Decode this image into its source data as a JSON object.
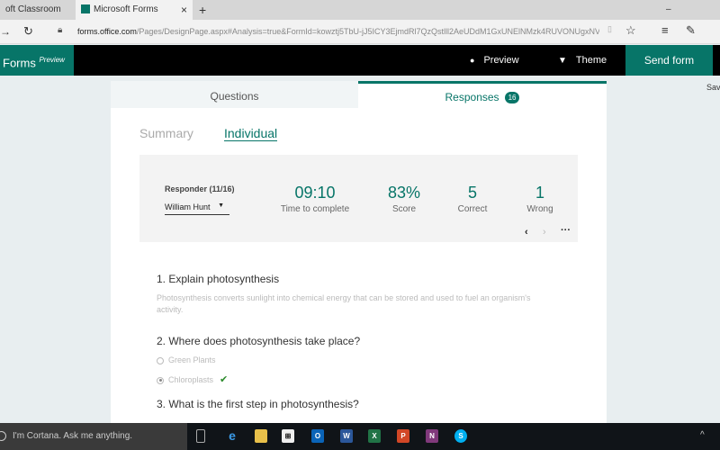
{
  "browser": {
    "tabs": [
      {
        "label": "oft Classroom"
      },
      {
        "label": "Microsoft Forms"
      }
    ],
    "new_tab": "+",
    "close": "×",
    "minimize": "–",
    "url_domain": "forms.office.com",
    "url_path": "/Pages/DesignPage.aspx#Analysis=true&FormId=kowztj5TbU-jJ5ICY3EjmdRl7QzQstlll2AeUDdM1GxUNElNMzk4RUVONUgxNVMyRVcwUlh"
  },
  "app": {
    "brand": "Forms",
    "brand_tag": "Preview",
    "preview": "Preview",
    "theme": "Theme",
    "send": "Send form",
    "saved": "Sav"
  },
  "tabs": {
    "questions": "Questions",
    "responses": "Responses",
    "responses_count": "16"
  },
  "subtabs": {
    "summary": "Summary",
    "individual": "Individual"
  },
  "responder": {
    "label": "Responder (11/16)",
    "name": "William Hunt"
  },
  "stats": [
    {
      "value": "09:10",
      "label": "Time to complete"
    },
    {
      "value": "83%",
      "label": "Score"
    },
    {
      "value": "5",
      "label": "Correct"
    },
    {
      "value": "1",
      "label": "Wrong"
    }
  ],
  "questions": [
    {
      "title": "1. Explain photosynthesis",
      "answer": "Photosynthesis converts sunlight into chemical energy that can be stored and used to fuel an organism's activity."
    },
    {
      "title": "2. Where does photosynthesis take place?",
      "options": [
        "Green Plants",
        "Chloroplasts"
      ]
    },
    {
      "title": "3. What is the first step in photosynthesis?"
    }
  ],
  "taskbar": {
    "cortana": "I'm Cortana. Ask me anything."
  },
  "colors": {
    "accent": "#077568"
  }
}
